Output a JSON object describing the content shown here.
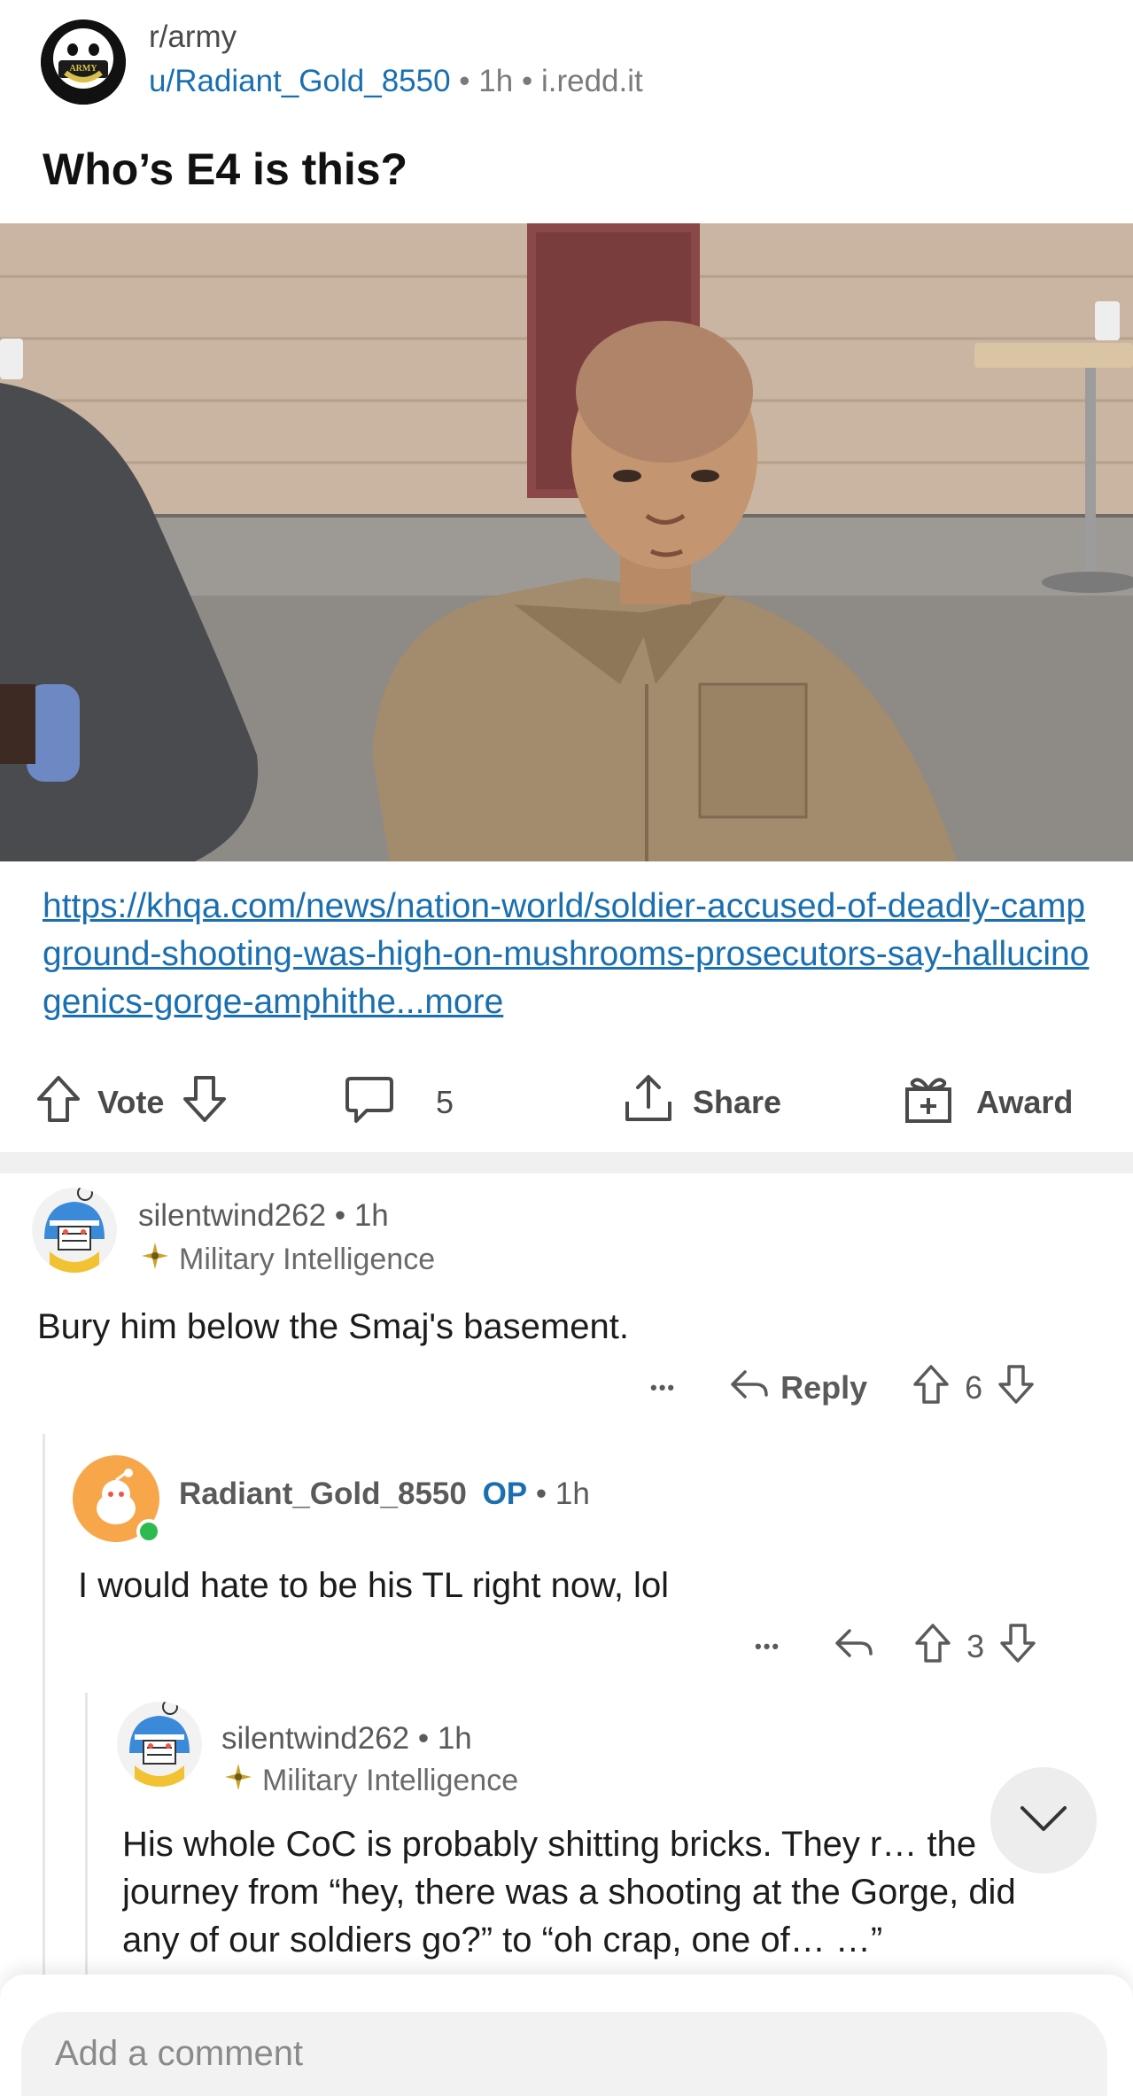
{
  "post": {
    "subreddit": "r/army",
    "author": "u/Radiant_Gold_8550",
    "age": "1h",
    "domain": "i.redd.it",
    "separator": "•",
    "title": "Who’s E4 is this?",
    "link_text": "https://khqa.com/news/nation-world/soldier-accused-of-deadly-campground-shooting-was-high-on-mushrooms-prosecutors-say-hallucinogenics-gorge-amphithe",
    "link_more": "...more"
  },
  "actions": {
    "vote_label": "Vote",
    "comment_count": "5",
    "share_label": "Share",
    "award_label": "Award"
  },
  "comments": [
    {
      "author": "silentwind262",
      "age": "1h",
      "flair": "Military Intelligence",
      "body": "Bury him below the Smaj's basement.",
      "reply_label": "Reply",
      "score": "6",
      "more": "•••"
    },
    {
      "author": "Radiant_Gold_8550",
      "op_badge": "OP",
      "age": "1h",
      "body": "I would hate to be his TL right now, lol",
      "score": "3",
      "more": "•••"
    },
    {
      "author": "silentwind262",
      "age": "1h",
      "flair": "Military Intelligence",
      "body": "His whole CoC is probably shitting bricks. They r… the journey from “hey, there was a shooting at the Gorge, did any of our soldiers go?” to “oh crap, one of… …”"
    }
  ],
  "comment_input": {
    "placeholder": "Add a comment"
  },
  "colors": {
    "link_blue": "#1a6fb0",
    "op_blue": "#1a6fb0",
    "online_green": "#2dbb4f",
    "avatar_orange": "#f7a64a"
  },
  "icons": [
    "upvote-icon",
    "downvote-icon",
    "comment-icon",
    "share-icon",
    "award-icon",
    "reply-icon",
    "more-icon",
    "chevron-down-icon"
  ]
}
